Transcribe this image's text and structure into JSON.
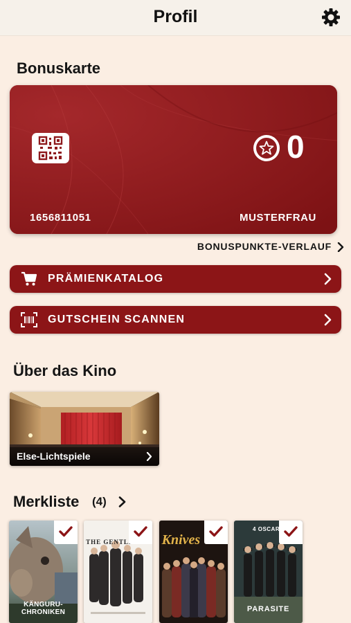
{
  "header": {
    "title": "Profil"
  },
  "bonus": {
    "heading": "Bonuskarte",
    "card_number": "1656811051",
    "holder_name": "MUSTERFRAU",
    "points": "0",
    "history_link": "BONUSPUNKTE-VERLAUF"
  },
  "actions": {
    "catalog_label": "PRÄMIENKATALOG",
    "scan_label": "GUTSCHEIN SCANNEN"
  },
  "cinema": {
    "heading": "Über das Kino",
    "name": "Else-Lichtspiele"
  },
  "watchlist": {
    "heading": "Merkliste",
    "count": "(4)",
    "posters": [
      {
        "title": "KÄNGURU-CHRONIKEN"
      },
      {
        "title": "THE GENTLEMEN"
      },
      {
        "title": "Knives Out"
      },
      {
        "title": "PARASITE",
        "badge": "4 OSCARS"
      }
    ]
  },
  "colors": {
    "accent": "#8c1517",
    "background": "#fbeee3",
    "card": "#8e1a1d"
  },
  "icons": {
    "settings": "gear-icon",
    "qr": "qr-code-icon",
    "points": "star-icon",
    "catalog": "cart-icon",
    "scan": "barcode-scan-icon",
    "watchlisted": "checkmark-icon"
  }
}
